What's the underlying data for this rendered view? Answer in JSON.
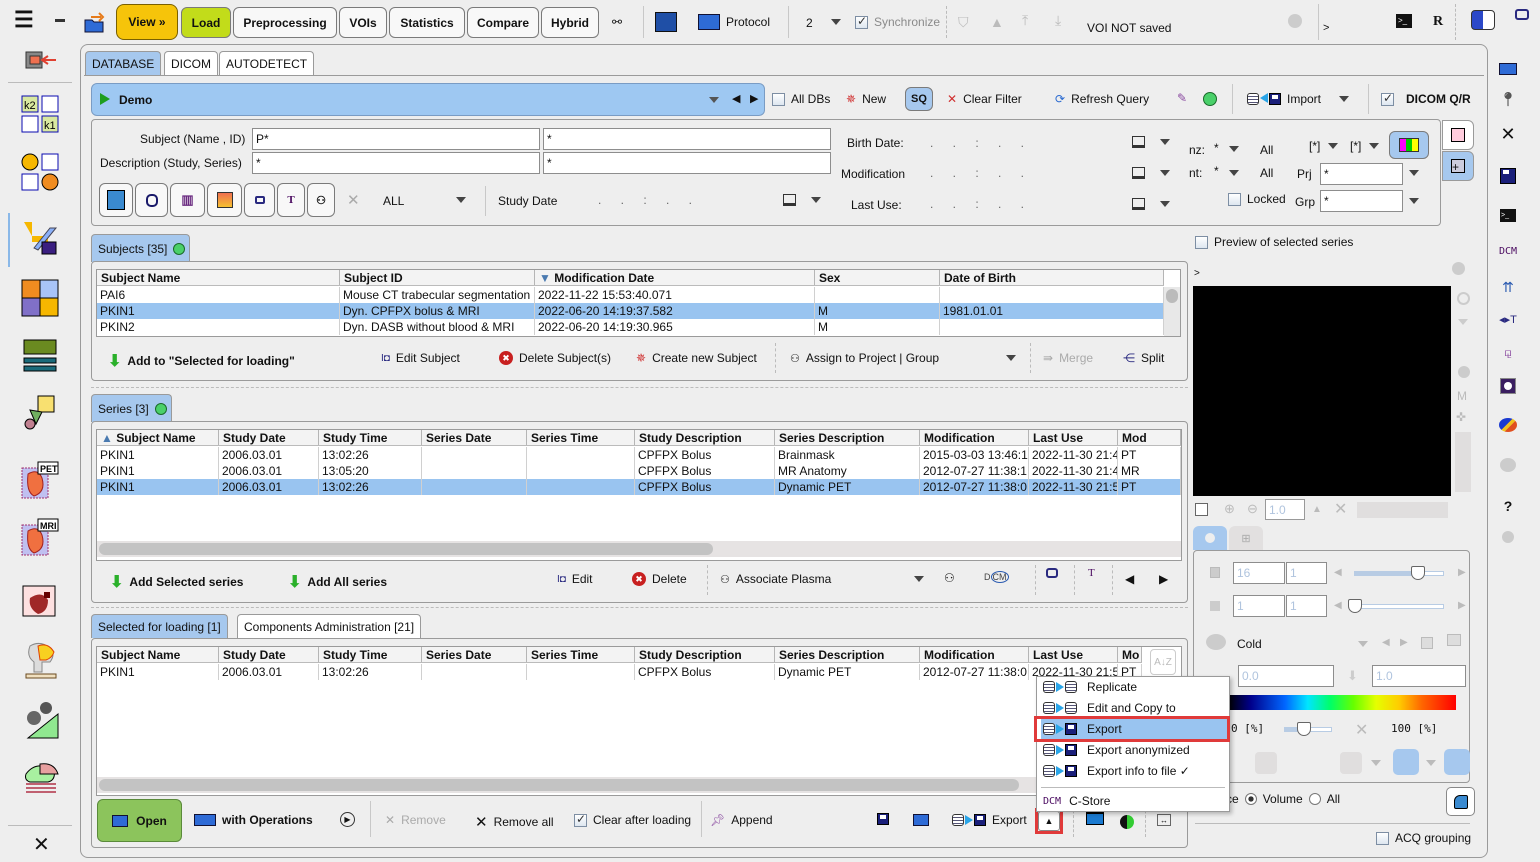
{
  "top_toolbar": {
    "view_label": "View »",
    "load_label": "Load",
    "tabs": [
      "Preprocessing",
      "VOIs",
      "Statistics",
      "Compare",
      "Hybrid"
    ],
    "protocol_label": "Protocol",
    "layout_value": "2",
    "synchronize_label": "Synchronize",
    "voi_status": "VOI NOT saved",
    "prompt": ">",
    "r_label": "R"
  },
  "source_tabs": [
    "DATABASE",
    "DICOM",
    "AUTODETECT"
  ],
  "database_bar": {
    "db_name": "Demo",
    "all_dbs_label": "All DBs",
    "new_label": "New",
    "sq_label": "SQ",
    "clear_filter_label": "Clear Filter",
    "refresh_query_label": "Refresh Query",
    "import_label": "Import",
    "dicom_qr_label": "DICOM Q/R"
  },
  "filters": {
    "subject_label": "Subject (Name , ID)",
    "subject_name_value": "P*",
    "subject_id_value": "*",
    "description_label": "Description (Study, Series)",
    "study_desc_value": "*",
    "series_desc_value": "*",
    "modality_value": "ALL",
    "study_date_label": "Study Date",
    "birth_date_label": "Birth Date:",
    "modification_label": "Modification",
    "last_use_label": "Last Use:",
    "nz_label": "nz:",
    "nz_value": "*",
    "nz_all": "All",
    "nt_label": "nt:",
    "nt_value": "*",
    "nt_all": "All",
    "bracket1": "[*]",
    "bracket2": "[*]",
    "prj_label": "Prj",
    "prj_value": "*",
    "grp_label": "Grp",
    "grp_value": "*",
    "locked_label": "Locked",
    "date_placeholder": ".   .   :   .   ."
  },
  "subjects": {
    "tab_label": "Subjects [35]",
    "columns": [
      "Subject Name",
      "Subject ID",
      "Modification Date",
      "Sex",
      "Date of Birth"
    ],
    "rows": [
      [
        "PAI6",
        "Mouse CT trabecular segmentation",
        "2022-11-22 15:53:40.071",
        "",
        ""
      ],
      [
        "PKIN1",
        "Dyn. CPFPX bolus & MRI",
        "2022-06-20 14:19:37.582",
        "M",
        "1981.01.01"
      ],
      [
        "PKIN2",
        "Dyn. DASB without blood & MRI",
        "2022-06-20 14:19:30.965",
        "M",
        ""
      ]
    ],
    "selected_row": 1,
    "actions": {
      "add_label": "Add to \"Selected for loading\"",
      "edit_label": "Edit Subject",
      "delete_label": "Delete Subject(s)",
      "create_label": "Create new Subject",
      "assign_label": "Assign to Project | Group",
      "merge_label": "Merge",
      "split_label": "Split"
    }
  },
  "series": {
    "tab_label": "Series [3]",
    "columns": [
      "Subject Name",
      "Study Date",
      "Study Time",
      "Series Date",
      "Series Time",
      "Study Description",
      "Series Description",
      "Modification",
      "Last Use",
      "Mod"
    ],
    "rows": [
      [
        "PKIN1",
        "2006.03.01",
        "13:02:26",
        "",
        "",
        "CPFPX Bolus",
        "Brainmask",
        "2015-03-03 13:46:1",
        "2022-11-30 21:4",
        "PT"
      ],
      [
        "PKIN1",
        "2006.03.01",
        "13:05:20",
        "",
        "",
        "CPFPX Bolus",
        "MR Anatomy",
        "2012-07-27 11:38:1",
        "2022-11-30 21:4",
        "MR"
      ],
      [
        "PKIN1",
        "2006.03.01",
        "13:02:26",
        "",
        "",
        "CPFPX Bolus",
        "Dynamic PET",
        "2012-07-27 11:38:0",
        "2022-11-30 21:5",
        "PT"
      ]
    ],
    "selected_row": 2,
    "actions": {
      "add_selected_label": "Add Selected series",
      "add_all_label": "Add All series",
      "edit_label": "Edit",
      "delete_label": "Delete",
      "associate_label": "Associate Plasma"
    }
  },
  "loading": {
    "tabs": [
      "Selected for loading  [1]",
      "Components Administration [21]"
    ],
    "columns": [
      "Subject Name",
      "Study Date",
      "Study Time",
      "Series Date",
      "Series Time",
      "Study Description",
      "Series Description",
      "Modification",
      "Last Use",
      "Mo"
    ],
    "rows": [
      [
        "PKIN1",
        "2006.03.01",
        "13:02:26",
        "",
        "",
        "CPFPX Bolus",
        "Dynamic PET",
        "2012-07-27 11:38:0",
        "2022-11-30 21:5",
        "PT"
      ]
    ]
  },
  "bottom_bar": {
    "open_label": "Open",
    "with_operations_label": "with Operations",
    "remove_label": "Remove",
    "remove_all_label": "Remove all",
    "clear_after_label": "Clear after loading",
    "append_label": "Append",
    "export_label": "Export"
  },
  "export_menu": {
    "items": [
      "Replicate",
      "Edit and Copy to",
      "Export",
      "Export anonymized",
      "Export info to file ✓",
      "C-Store"
    ],
    "dcm_label": "DCM",
    "highlighted_index": 2
  },
  "preview": {
    "preview_label": "Preview of selected series",
    "prompt": ">",
    "zoom_value": "1.0",
    "slice_value": "16",
    "slice_step": "1",
    "frame_value": "1",
    "frame_step": "1",
    "colortable": "Cold",
    "min_value": "0.0",
    "max_value": "1.0",
    "lower_pct": "0 [%]",
    "upper_pct": "100 [%]",
    "slice_slider_fraction": 0.7,
    "frame_slider_fraction": 0.0,
    "threshold_slider_fraction": 0.4,
    "scope_options": [
      "Slice",
      "Volume",
      "All"
    ],
    "scope_selected": "Volume",
    "acq_grouping_label": "ACQ grouping"
  },
  "right_sidebar": {
    "dcm_label": "DCM",
    "help_label": "?"
  }
}
